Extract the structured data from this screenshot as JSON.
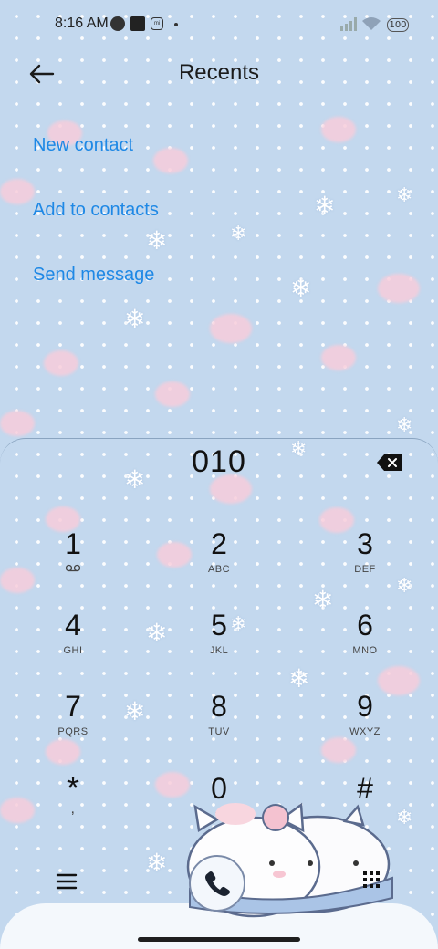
{
  "status_bar": {
    "time": "8:16 AM",
    "battery": "100",
    "icons": [
      "notification-circle-icon",
      "square-notification-icon",
      "mi-icon",
      "dot-icon",
      "signal-icon",
      "wifi-icon",
      "battery-icon"
    ]
  },
  "header": {
    "title": "Recents",
    "back_icon": "back-arrow-icon"
  },
  "actions": [
    {
      "label": "New contact"
    },
    {
      "label": "Add to contacts"
    },
    {
      "label": "Send message"
    }
  ],
  "dialer": {
    "number": "010",
    "backspace_icon": "backspace-icon",
    "keys": [
      {
        "digit": "1",
        "letters": ""
      },
      {
        "digit": "2",
        "letters": "ABC"
      },
      {
        "digit": "3",
        "letters": "DEF"
      },
      {
        "digit": "4",
        "letters": "GHI"
      },
      {
        "digit": "5",
        "letters": "JKL"
      },
      {
        "digit": "6",
        "letters": "MNO"
      },
      {
        "digit": "7",
        "letters": "PQRS"
      },
      {
        "digit": "8",
        "letters": "TUV"
      },
      {
        "digit": "9",
        "letters": "WXYZ"
      },
      {
        "digit": "*",
        "letters": ","
      },
      {
        "digit": "0",
        "letters": "+"
      },
      {
        "digit": "#",
        "letters": ""
      }
    ]
  },
  "bottom_bar": {
    "menu_icon": "menu-icon",
    "call_icon": "phone-icon",
    "keypad_icon": "dialpad-icon"
  },
  "colors": {
    "accent": "#1e88e5",
    "background": "#c3d8ee"
  }
}
